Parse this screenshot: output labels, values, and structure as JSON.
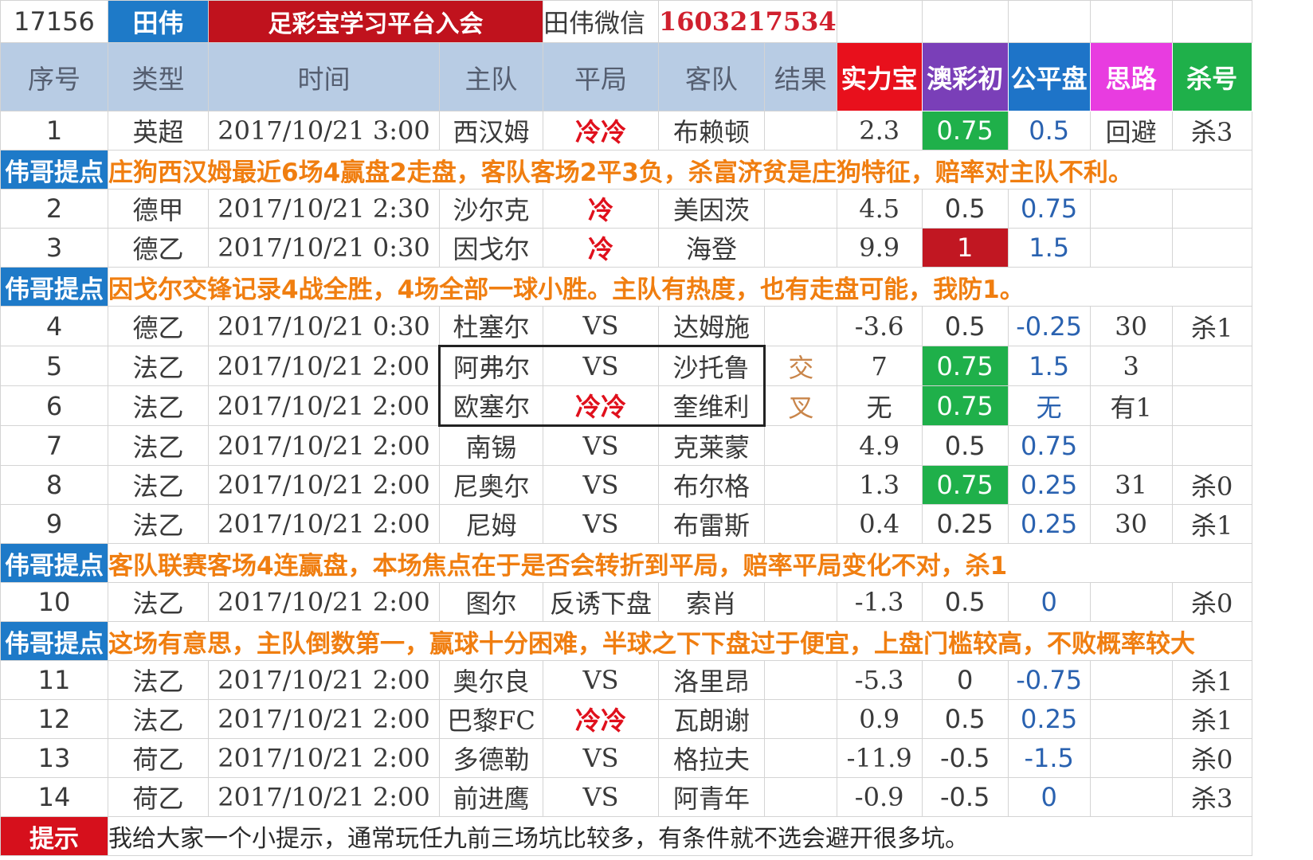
{
  "banner": {
    "id": "17156",
    "name": "田伟",
    "join_text": "足彩宝学习平台入会",
    "wechat_label": "田伟微信",
    "phone": "1603217534"
  },
  "columns": [
    "序号",
    "类型",
    "时间",
    "主队",
    "平局",
    "客队",
    "结果",
    "实力宝",
    "澳彩初",
    "公平盘",
    "思路",
    "杀号"
  ],
  "highlight_colors": {
    "实力宝": "#e8101c",
    "澳彩初": "#7a3fb8",
    "公平盘": "#1e74c8",
    "思路": "#e83ce0",
    "杀号": "#1fb04a"
  },
  "matches": [
    {
      "no": "1",
      "league": "英超",
      "time": "2017/10/21  3:00",
      "home": "西汉姆",
      "draw": "冷冷",
      "away": "布赖顿",
      "result": "",
      "strength": "2.3",
      "aocai": "0.75",
      "fair": "0.5",
      "idea": "回避",
      "kill": "杀3"
    },
    {
      "no": "2",
      "league": "德甲",
      "time": "2017/10/21  2:30",
      "home": "沙尔克",
      "draw": "冷",
      "away": "美因茨",
      "result": "",
      "strength": "4.5",
      "aocai": "0.5",
      "fair": "0.75",
      "idea": "",
      "kill": ""
    },
    {
      "no": "3",
      "league": "德乙",
      "time": "2017/10/21  0:30",
      "home": "因戈尔",
      "draw": "冷",
      "away": "海登",
      "result": "",
      "strength": "9.9",
      "aocai": "1",
      "fair": "1.5",
      "idea": "",
      "kill": ""
    },
    {
      "no": "4",
      "league": "德乙",
      "time": "2017/10/21  0:30",
      "home": "杜塞尔",
      "draw": "VS",
      "away": "达姆施",
      "result": "",
      "strength": "-3.6",
      "aocai": "0.5",
      "fair": "-0.25",
      "idea": "30",
      "kill": "杀1"
    },
    {
      "no": "5",
      "league": "法乙",
      "time": "2017/10/21  2:00",
      "home": "阿弗尔",
      "draw": "VS",
      "away": "沙托鲁",
      "result": "交",
      "strength": "7",
      "aocai": "0.75",
      "fair": "1.5",
      "idea": "3",
      "kill": ""
    },
    {
      "no": "6",
      "league": "法乙",
      "time": "2017/10/21  2:00",
      "home": "欧塞尔",
      "draw": "冷冷",
      "away": "奎维利",
      "result": "叉",
      "strength": "无",
      "aocai": "0.75",
      "fair": "无",
      "idea": "有1",
      "kill": ""
    },
    {
      "no": "7",
      "league": "法乙",
      "time": "2017/10/21  2:00",
      "home": "南锡",
      "draw": "VS",
      "away": "克莱蒙",
      "result": "",
      "strength": "4.9",
      "aocai": "0.5",
      "fair": "0.75",
      "idea": "",
      "kill": ""
    },
    {
      "no": "8",
      "league": "法乙",
      "time": "2017/10/21  2:00",
      "home": "尼奥尔",
      "draw": "VS",
      "away": "布尔格",
      "result": "",
      "strength": "1.3",
      "aocai": "0.75",
      "fair": "0.25",
      "idea": "31",
      "kill": "杀0"
    },
    {
      "no": "9",
      "league": "法乙",
      "time": "2017/10/21  2:00",
      "home": "尼姆",
      "draw": "VS",
      "away": "布雷斯",
      "result": "",
      "strength": "0.4",
      "aocai": "0.25",
      "fair": "0.25",
      "idea": "30",
      "kill": "杀1"
    },
    {
      "no": "10",
      "league": "法乙",
      "time": "2017/10/21  2:00",
      "home": "图尔",
      "draw": "反诱下盘",
      "away": "索肖",
      "result": "",
      "strength": "-1.3",
      "aocai": "0.5",
      "fair": "0",
      "idea": "",
      "kill": "杀0"
    },
    {
      "no": "11",
      "league": "法乙",
      "time": "2017/10/21  2:00",
      "home": "奥尔良",
      "draw": "VS",
      "away": "洛里昂",
      "result": "",
      "strength": "-5.3",
      "aocai": "0",
      "fair": "-0.75",
      "idea": "",
      "kill": "杀1"
    },
    {
      "no": "12",
      "league": "法乙",
      "time": "2017/10/21  2:00",
      "home": "巴黎FC",
      "draw": "冷冷",
      "away": "瓦朗谢",
      "result": "",
      "strength": "0.9",
      "aocai": "0.5",
      "fair": "0.25",
      "idea": "",
      "kill": "杀1"
    },
    {
      "no": "13",
      "league": "荷乙",
      "time": "2017/10/21  2:00",
      "home": "多德勒",
      "draw": "VS",
      "away": "格拉夫",
      "result": "",
      "strength": "-11.9",
      "aocai": "-0.5",
      "fair": "-1.5",
      "idea": "",
      "kill": "杀0"
    },
    {
      "no": "14",
      "league": "荷乙",
      "time": "2017/10/21  2:00",
      "home": "前进鹰",
      "draw": "VS",
      "away": "阿青年",
      "result": "",
      "strength": "-0.9",
      "aocai": "-0.5",
      "fair": "0",
      "idea": "",
      "kill": "杀3"
    }
  ],
  "notes": [
    {
      "label": "伟哥提点",
      "text": "庄狗西汉姆最近6场4赢盘2走盘，客队客场2平3负，杀富济贫是庄狗特征，赔率对主队不利。"
    },
    {
      "label": "伟哥提点",
      "text": "因戈尔交锋记录4战全胜，4场全部一球小胜。主队有热度，也有走盘可能，我防1。"
    },
    {
      "label": "伟哥提点",
      "text": "客队联赛客场4连赢盘，本场焦点在于是否会转折到平局，赔率平局变化不对，杀1"
    },
    {
      "label": "伟哥提点",
      "text": "这场有意思，主队倒数第一，赢球十分困难，半球之下下盘过于便宜，上盘门槛较高，不败概率较大"
    }
  ],
  "footer": {
    "label": "提示",
    "text": "我给大家一个小提示，通常玩任九前三场坑比较多，有条件就不选会避开很多坑。"
  }
}
